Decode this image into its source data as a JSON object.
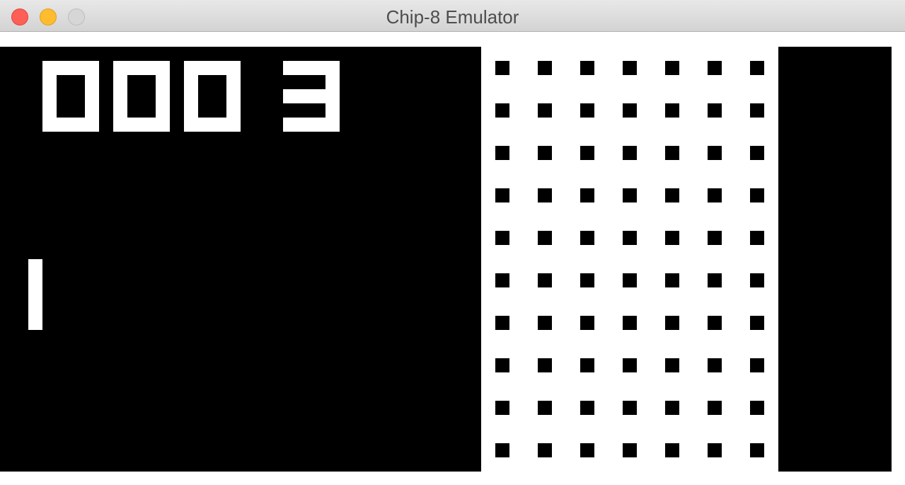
{
  "window": {
    "title": "Chip-8 Emulator",
    "controls": [
      {
        "name": "close-button",
        "color": "#fe5f57"
      },
      {
        "name": "minimize-button",
        "color": "#febc2e"
      },
      {
        "name": "zoom-button",
        "color": "#d6d6d6"
      }
    ]
  },
  "display": {
    "foreground": "#ffffff",
    "background": "#000000",
    "score_digits": [
      "0",
      "0",
      "0",
      "3"
    ],
    "paddle": "left",
    "net": "dotted-grid"
  }
}
